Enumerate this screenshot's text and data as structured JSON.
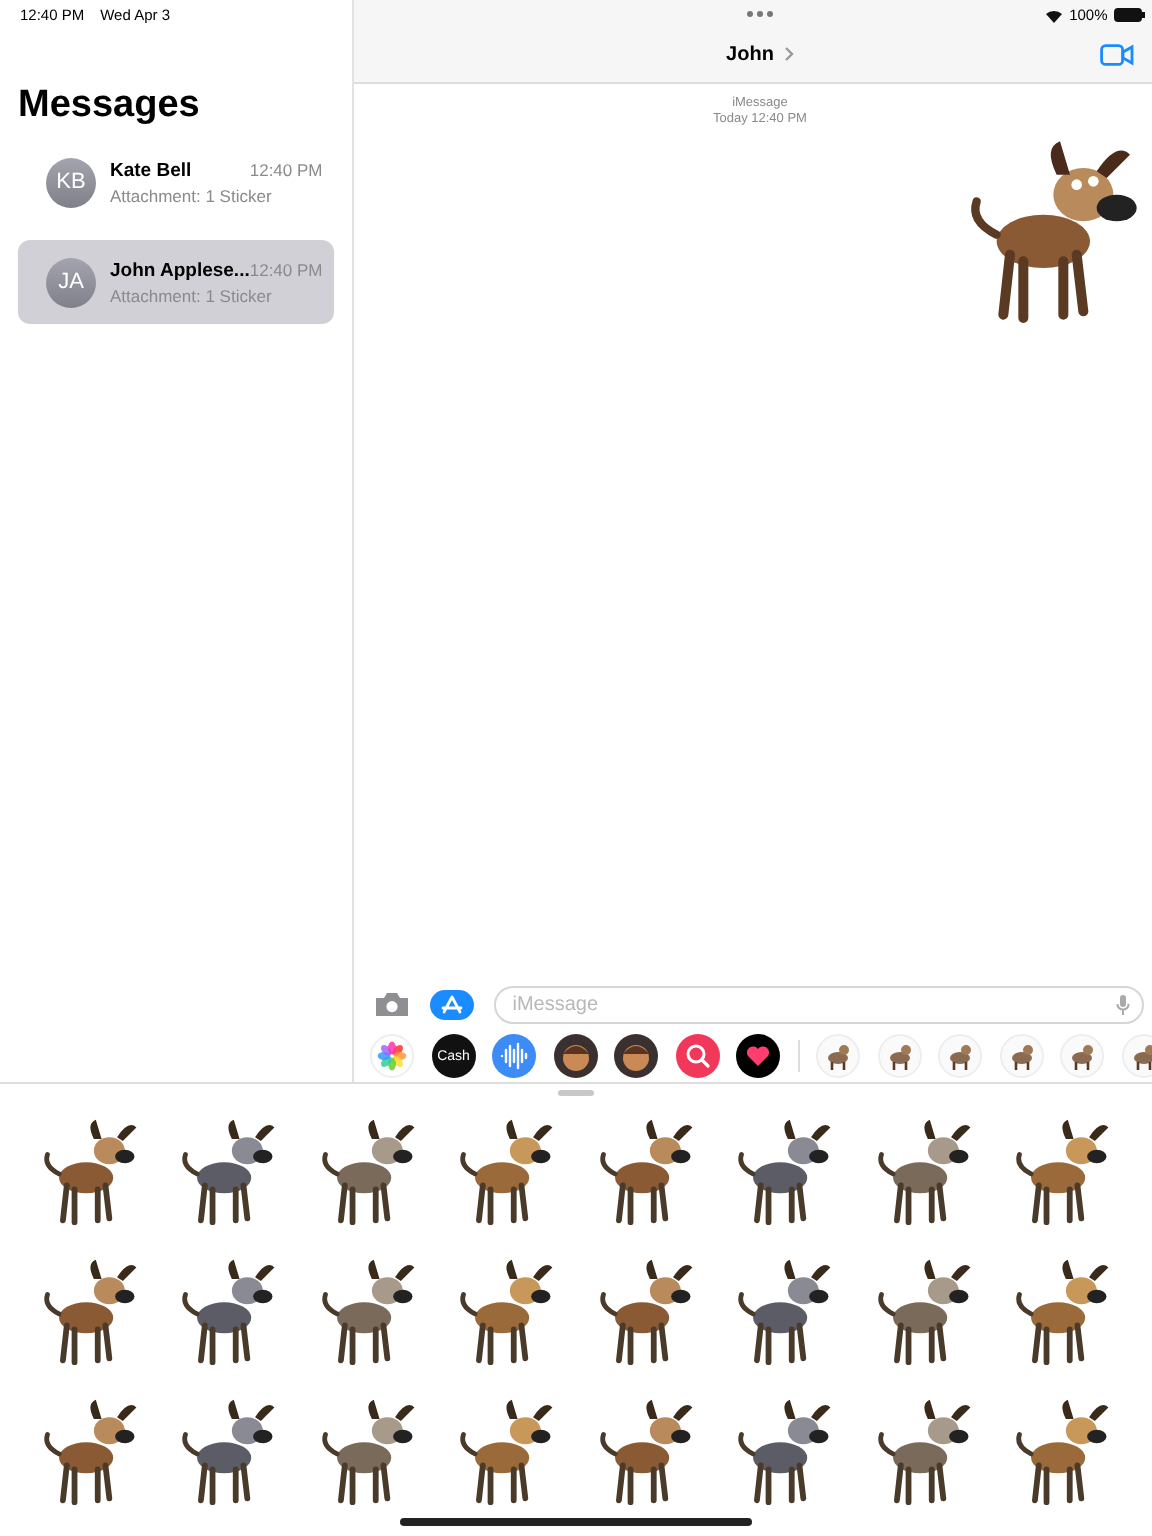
{
  "status_bar": {
    "time": "12:40 PM",
    "date": "Wed Apr 3",
    "battery": "100%"
  },
  "sidebar": {
    "title": "Messages",
    "conversations": [
      {
        "initials": "KB",
        "name": "Kate Bell",
        "time": "12:40 PM",
        "preview": "Attachment: 1 Sticker",
        "selected": false
      },
      {
        "initials": "JA",
        "name": "John Applese...",
        "time": "12:40 PM",
        "preview": "Attachment: 1 Sticker",
        "selected": true
      }
    ]
  },
  "chat": {
    "contact": "John",
    "service": "iMessage",
    "timestamp": "Today 12:40 PM"
  },
  "composer": {
    "placeholder": "iMessage"
  },
  "app_strip": [
    {
      "kind": "photos"
    },
    {
      "kind": "cash",
      "label": "Cash"
    },
    {
      "kind": "audio"
    },
    {
      "kind": "memoji"
    },
    {
      "kind": "memoji"
    },
    {
      "kind": "search"
    },
    {
      "kind": "heart"
    },
    {
      "kind": "divider"
    },
    {
      "kind": "sticker"
    },
    {
      "kind": "sticker"
    },
    {
      "kind": "sticker"
    },
    {
      "kind": "sticker"
    },
    {
      "kind": "sticker"
    },
    {
      "kind": "sticker"
    }
  ]
}
